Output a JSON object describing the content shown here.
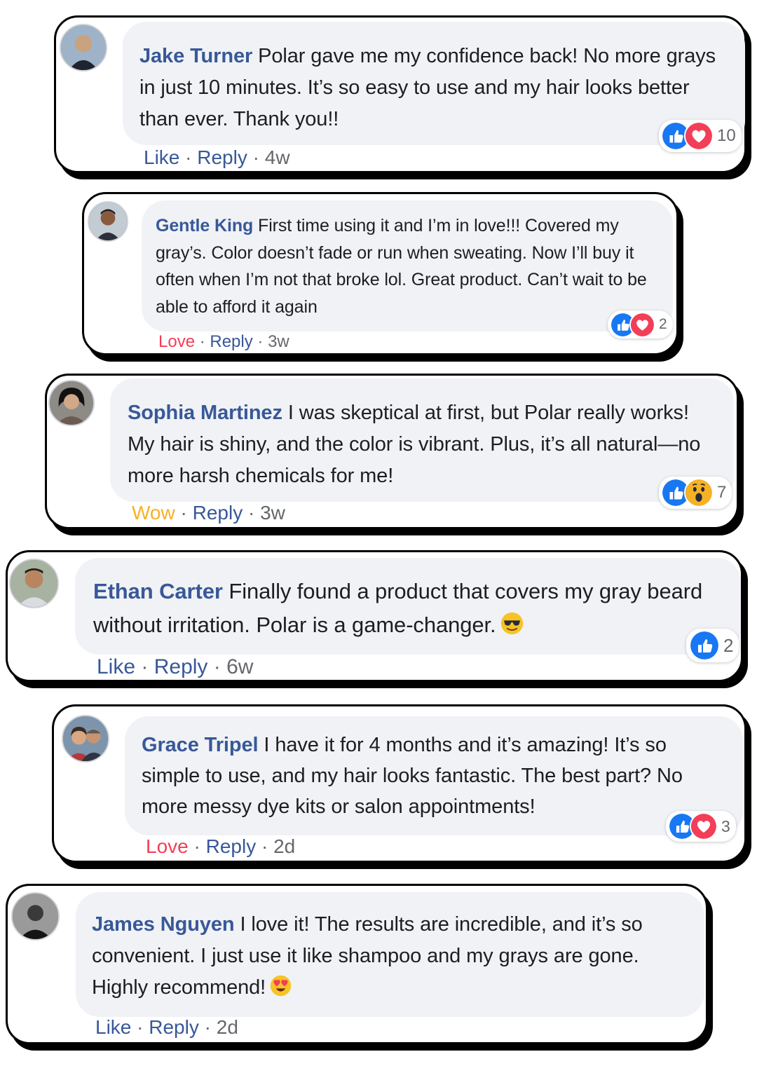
{
  "colors": {
    "link": "#385898",
    "love": "#f33e58",
    "wow": "#f7b125",
    "muted": "#65676b",
    "bubble": "#f0f2f5"
  },
  "comments": [
    {
      "name": "Jake Turner",
      "text": "Polar gave me my confidence back! No more grays in just 10 minutes. It’s so easy to use and my hair looks better than ever. Thank you!!",
      "action": "Like",
      "reply": "Reply",
      "time": "4w",
      "reactions": [
        "like-icon",
        "love-icon"
      ],
      "reaction_count": "10"
    },
    {
      "name": "Gentle King",
      "text": "First time using it and I’m in love!!! Covered my gray’s. Color doesn’t fade or run when sweating. Now I’ll buy it often when I’m not that broke lol. Great product. Can’t wait to be able to afford it again",
      "action": "Love",
      "reply": "Reply",
      "time": "3w",
      "reactions": [
        "like-icon",
        "love-icon"
      ],
      "reaction_count": "2"
    },
    {
      "name": "Sophia Martinez",
      "text": "I was skeptical at first, but Polar really works! My hair is shiny, and the color is vibrant. Plus, it’s all natural—no more harsh chemicals for me!",
      "action": "Wow",
      "reply": "Reply",
      "time": "3w",
      "reactions": [
        "like-icon",
        "wow-icon"
      ],
      "reaction_count": "7"
    },
    {
      "name": "Ethan Carter",
      "text": "Finally found a product that covers my gray beard without irritation. Polar is a game-changer.",
      "action": "Like",
      "reply": "Reply",
      "time": "6w",
      "reactions": [
        "like-icon"
      ],
      "reaction_count": "2",
      "emoji": "sunglasses-emoji"
    },
    {
      "name": "Grace Tripel",
      "text": "I have it for 4 months and it’s amazing! It’s so simple to use, and my hair looks fantastic. The best part? No more messy dye kits or salon appointments!",
      "action": "Love",
      "reply": "Reply",
      "time": "2d",
      "reactions": [
        "like-icon",
        "love-icon"
      ],
      "reaction_count": "3"
    },
    {
      "name": "James Nguyen",
      "text": "I love it! The results are incredible, and it’s so convenient. I just use it like shampoo and my grays are gone. Highly recommend!",
      "action": "Like",
      "reply": "Reply",
      "time": "2d",
      "reactions": [],
      "reaction_count": "",
      "emoji": "heart-eyes-emoji"
    }
  ]
}
